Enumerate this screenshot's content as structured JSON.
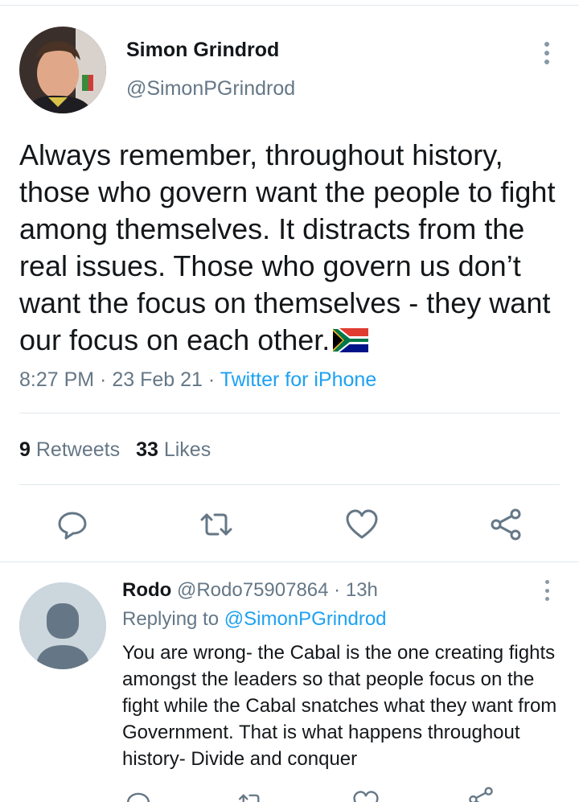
{
  "tweet": {
    "author_name": "Simon Grindrod",
    "author_handle": "@SimonPGrindrod",
    "text": "Always remember, throughout history, those who govern want the people to fight among themselves. It distracts from the real issues. Those who govern us don’t want the focus on themselves - they want our focus on each other.",
    "emoji": "south-africa-flag",
    "time": "8:27 PM",
    "date": "23 Feb 21",
    "source": "Twitter for iPhone",
    "separator": " · ",
    "retweets_count": "9",
    "retweets_label": "Retweets",
    "likes_count": "33",
    "likes_label": "Likes"
  },
  "actions": {
    "reply_icon": "reply-icon",
    "retweet_icon": "retweet-icon",
    "like_icon": "heart-icon",
    "share_icon": "share-icon"
  },
  "reply": {
    "author_name": "Rodo",
    "author_handle": "@Rodo75907864",
    "age": "13h",
    "replying_to_label": "Replying to",
    "replying_to_handle": "@SimonPGrindrod",
    "text": "You are wrong- the Cabal is the one creating fights amongst the leaders so that people focus on the fight while the Cabal snatches what they want from Government. That is what happens throughout history- Divide and conquer"
  },
  "colors": {
    "accent": "#1da1f2",
    "secondary_text": "#657786",
    "primary_text": "#14171a",
    "divider": "#e1e8ed"
  }
}
